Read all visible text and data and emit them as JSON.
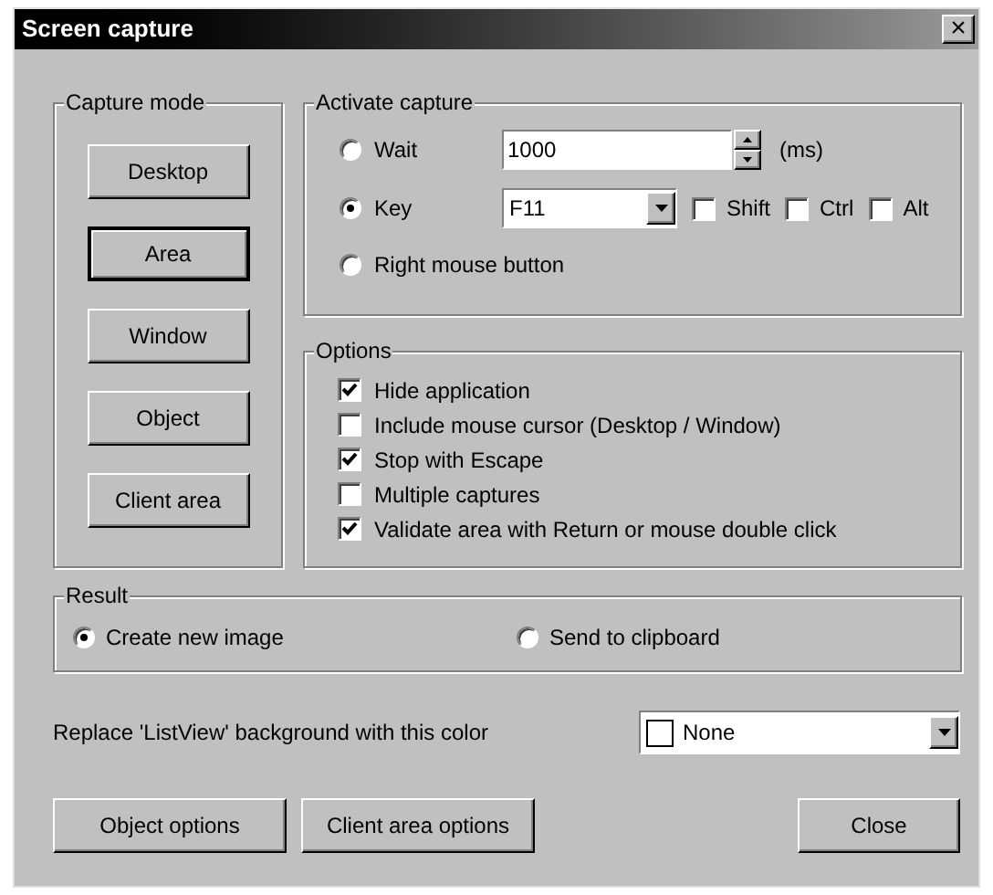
{
  "window": {
    "title": "Screen capture",
    "close_glyph": "×"
  },
  "capture_mode": {
    "title": "Capture mode",
    "buttons": [
      {
        "label": "Desktop",
        "selected": false
      },
      {
        "label": "Area",
        "selected": true
      },
      {
        "label": "Window",
        "selected": false
      },
      {
        "label": "Object",
        "selected": false
      },
      {
        "label": "Client area",
        "selected": false
      }
    ]
  },
  "activate_capture": {
    "title": "Activate capture",
    "wait": {
      "label": "Wait",
      "selected": false,
      "value": "1000",
      "unit": "(ms)"
    },
    "key": {
      "label": "Key",
      "selected": true,
      "value": "F11",
      "modifiers": [
        {
          "label": "Shift",
          "checked": false
        },
        {
          "label": "Ctrl",
          "checked": false
        },
        {
          "label": "Alt",
          "checked": false
        }
      ]
    },
    "right_mouse": {
      "label": "Right mouse button",
      "selected": false
    }
  },
  "options": {
    "title": "Options",
    "items": [
      {
        "label": "Hide application",
        "checked": true
      },
      {
        "label": "Include mouse cursor (Desktop / Window)",
        "checked": false
      },
      {
        "label": "Stop with Escape",
        "checked": true
      },
      {
        "label": "Multiple captures",
        "checked": false
      },
      {
        "label": "Validate area with Return or mouse double click",
        "checked": true
      }
    ]
  },
  "result": {
    "title": "Result",
    "choices": [
      {
        "label": "Create new image",
        "selected": true
      },
      {
        "label": "Send to clipboard",
        "selected": false
      }
    ]
  },
  "listview_color": {
    "label": "Replace 'ListView' background with this color",
    "value": "None",
    "color": "#ffffff"
  },
  "buttons": [
    "Object options",
    "Client area options",
    "Close"
  ]
}
